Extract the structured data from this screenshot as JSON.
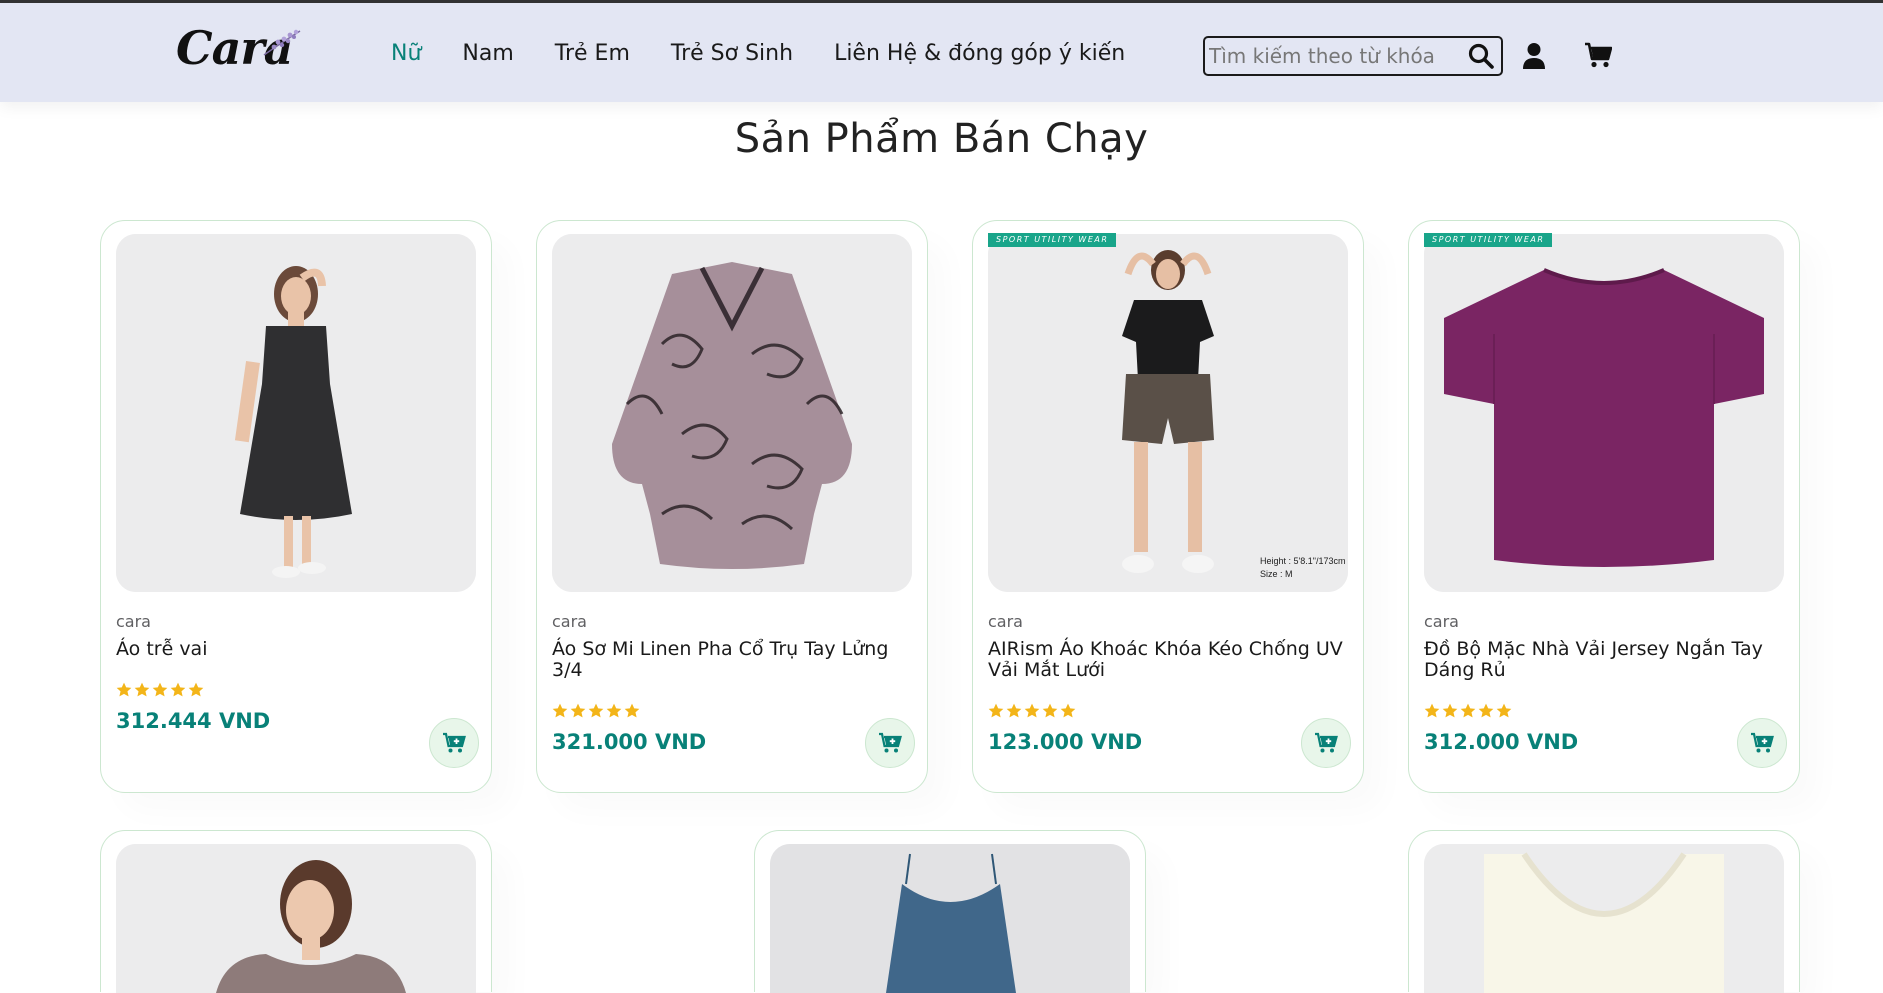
{
  "header": {
    "logo_text": "Cara",
    "nav": [
      {
        "label": "Nữ",
        "active": true
      },
      {
        "label": "Nam",
        "active": false
      },
      {
        "label": "Trẻ Em",
        "active": false
      },
      {
        "label": "Trẻ Sơ Sinh",
        "active": false
      },
      {
        "label": "Liên Hệ & đóng góp ý kiến",
        "active": false
      }
    ],
    "search": {
      "placeholder": "Tìm kiếm theo từ khóa",
      "value": ""
    },
    "icons": [
      "search-icon",
      "user-icon",
      "cart-icon"
    ]
  },
  "section": {
    "title": "Sản Phẩm Bán Chạy"
  },
  "colors": {
    "accent": "#088178",
    "header_bg": "#e3e6f3",
    "star": "#f3b519",
    "card_border": "#cce7d0",
    "tag": "#19a58a"
  },
  "products": [
    {
      "brand": "cara",
      "name": "Áo trễ vai",
      "price": "312.444 VND",
      "rating": 5,
      "tag": ""
    },
    {
      "brand": "cara",
      "name": "Áo Sơ Mi Linen Pha Cổ Trụ Tay Lửng 3/4",
      "price": "321.000 VND",
      "rating": 5,
      "tag": ""
    },
    {
      "brand": "cara",
      "name": "AIRism Áo Khoác Khóa Kéo Chống UV Vải Mắt Lưới",
      "price": "123.000 VND",
      "rating": 5,
      "tag": "SPORT UTILITY WEAR",
      "image_caption": "Height : 5'8.1\"/173cm\nSize : M"
    },
    {
      "brand": "cara",
      "name": "Đồ Bộ Mặc Nhà Vải Jersey Ngắn Tay Dáng Rủ",
      "price": "312.000 VND",
      "rating": 5,
      "tag": "SPORT UTILITY WEAR"
    }
  ]
}
